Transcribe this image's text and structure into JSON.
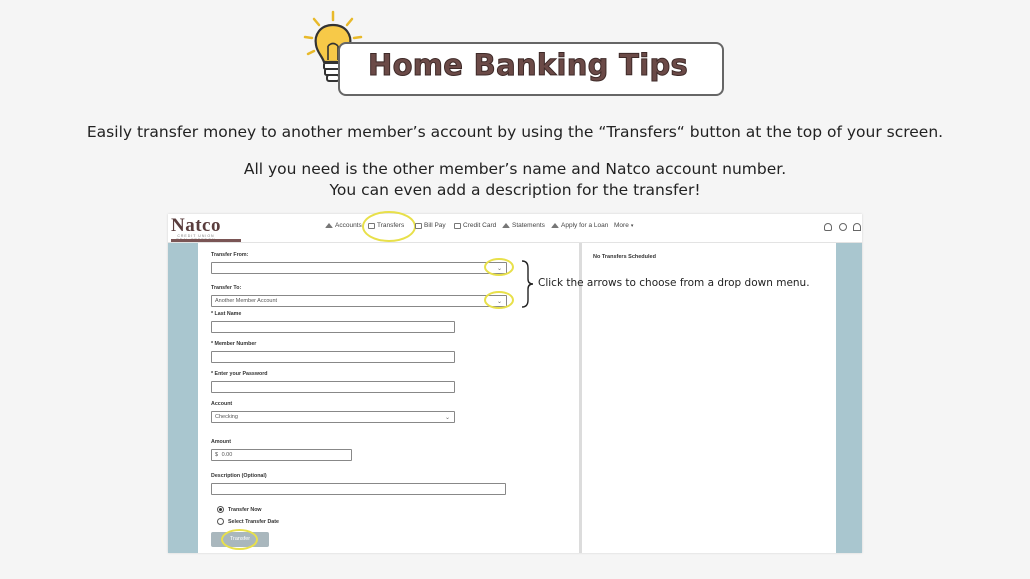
{
  "banner": {
    "title": "Home Banking Tips",
    "icon": "lightbulb-icon",
    "title_color": "#6b4a47"
  },
  "intro": {
    "line1": "Easily transfer money to another member’s account by using the “Transfers“ button at the top of your screen.",
    "line2": "All you need is the other member’s name and Natco account number.",
    "line3": "You can even add a description for the transfer!"
  },
  "app": {
    "logo": {
      "name": "Natco",
      "tagline": "CREDIT UNION",
      "subline": "REAL FREEDOM"
    },
    "nav": [
      {
        "label": "Accounts",
        "icon": "house-icon"
      },
      {
        "label": "Transfers",
        "icon": "transfer-icon"
      },
      {
        "label": "Bill Pay",
        "icon": "bill-icon"
      },
      {
        "label": "Credit Card",
        "icon": "credit-card-icon"
      },
      {
        "label": "Statements",
        "icon": "statements-icon"
      },
      {
        "label": "Apply for a Loan",
        "icon": "loan-icon"
      },
      {
        "label": "More",
        "icon": "chevron-down-icon"
      }
    ],
    "form": {
      "transfer_from_label": "Transfer From:",
      "transfer_from_value": "",
      "transfer_to_label": "Transfer To:",
      "transfer_to_value": "Another Member Account",
      "last_name_label": "* Last Name",
      "member_number_label": "* Member Number",
      "password_label": "* Enter your Password",
      "account_label": "Account",
      "account_value": "Checking",
      "amount_label": "Amount",
      "amount_currency": "$",
      "amount_value": "0.00",
      "description_label": "Description (Optional)",
      "radio_now": "Transfer Now",
      "radio_date": "Select Transfer Date",
      "submit_label": "Transfer"
    },
    "right_panel": {
      "heading": "No Transfers Scheduled"
    },
    "accent_strip_color": "#a9c6cf",
    "highlight_color": "#e8e04a"
  },
  "annotation": {
    "callout": "Click the arrows to choose from a drop down menu."
  }
}
